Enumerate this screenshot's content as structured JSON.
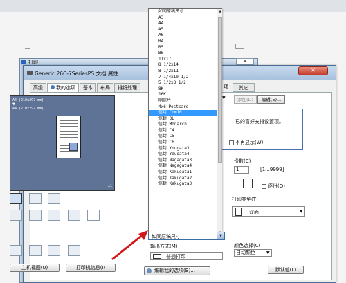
{
  "outer_dialog": {
    "title": "打印",
    "close": "✕"
  },
  "dialog": {
    "title": "Generic 26C-7SeriesPS 文档 属性",
    "close": "✕",
    "tabs": [
      "高级",
      "我的选项",
      "基本",
      "布局",
      "排纸处理"
    ],
    "tab_right_partial": "项",
    "tab_other": "其它"
  },
  "preview": {
    "line1": "A4 (210x297 mm)",
    "line2": "A4 (210x297 mm)",
    "copies_marker": "x1"
  },
  "buttons": {
    "main_view": "主机视图(U)",
    "printer_info": "打印机信息(I)",
    "add": "添加(D)",
    "edit": "编辑(E)...",
    "default": "默认值(L)",
    "edit_favorites": "编辑我的选项(B)..."
  },
  "favorites": {
    "label_partial": "喜"
  },
  "info_text": "已的喜好安排设置项。",
  "no_show": "不再显示(W)",
  "copies": {
    "label": "份数(C)",
    "value": "1",
    "range": "[1...9999]"
  },
  "collate": "逐份(Q)",
  "print_type": {
    "label": "打印类型(T)",
    "value": "双面"
  },
  "output": {
    "label": "输出方式(M)",
    "value": "普通打印"
  },
  "color": {
    "label": "颜色选择(C)",
    "value": "自动颜色"
  },
  "paper_size_combo": {
    "value": "如同原稿尺寸"
  },
  "dropdown": {
    "selected_index": 17,
    "options": [
      "如同原稿尺寸",
      "A3",
      "A4",
      "A5",
      "A6",
      "B4",
      "B5",
      "B6",
      "11x17",
      "8 1/2x14",
      "8 1/2x11",
      "7 1/4x10 1/2",
      "5 1/2x8 1/2",
      "8K",
      "16K",
      "明信片",
      "4x6 Postcard",
      "信封 Com10",
      "信封 DL",
      "信封 Monarch",
      "信封 C4",
      "信封 C5",
      "信封 C6",
      "信封 Yougata3",
      "信封 Yougata4",
      "信封 Nagagata3",
      "信封 Nagagata4",
      "信封 Kakugata1",
      "信封 Kakugata2",
      "信封 Kakugata3"
    ]
  }
}
